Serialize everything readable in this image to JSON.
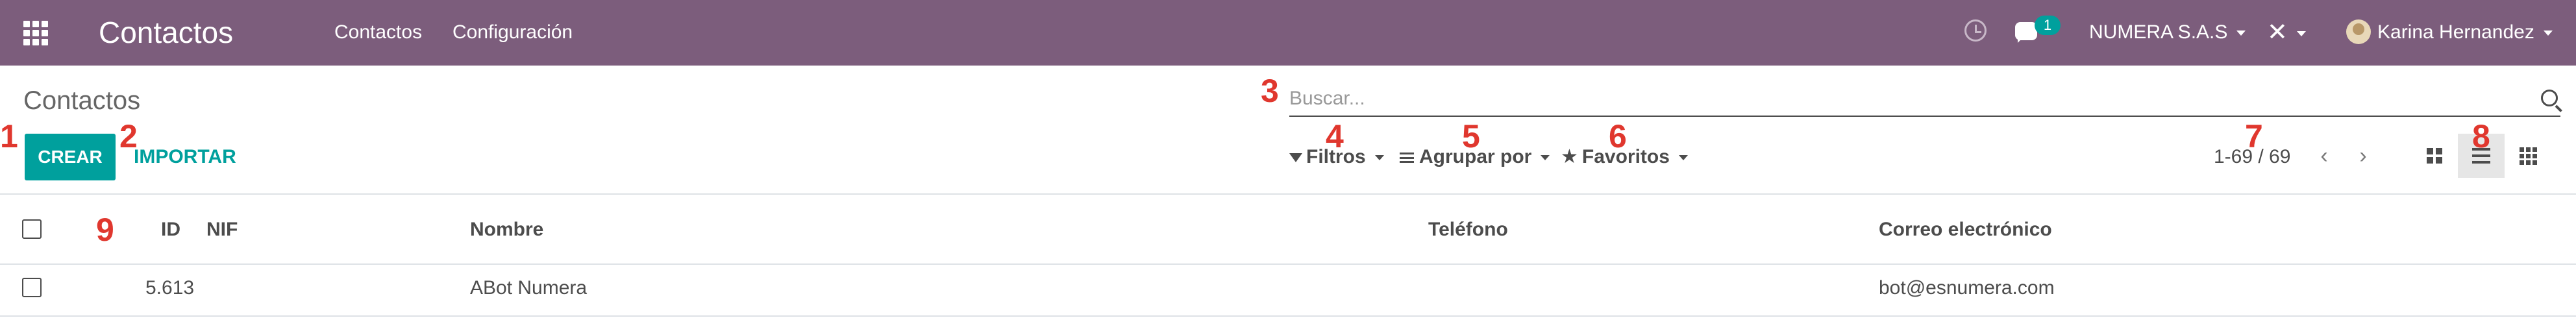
{
  "navbar": {
    "brand": "Contactos",
    "menu": [
      "Contactos",
      "Configuración"
    ],
    "chat_count": "1",
    "company": "NUMERA S.A.S",
    "user": "Karina Hernandez",
    "background": "#7c5d7c"
  },
  "control_panel": {
    "breadcrumb": "Contactos",
    "create_label": "CREAR",
    "import_label": "IMPORTAR",
    "search_placeholder": "Buscar...",
    "filters_label": "Filtros",
    "group_by_label": "Agrupar por",
    "favorites_label": "Favoritos",
    "pager": "1-69 / 69",
    "active_view": "list",
    "accent": "#00a09d"
  },
  "table": {
    "columns": [
      "ID",
      "NIF",
      "Nombre",
      "Teléfono",
      "Correo electrónico"
    ],
    "rows": [
      {
        "id": "5.613",
        "nif": "",
        "name": "ABot Numera",
        "phone": "",
        "email": "bot@esnumera.com"
      }
    ]
  },
  "annotations": [
    "1",
    "2",
    "3",
    "4",
    "5",
    "6",
    "7",
    "8",
    "9"
  ],
  "annotation_color": "#e0372e"
}
